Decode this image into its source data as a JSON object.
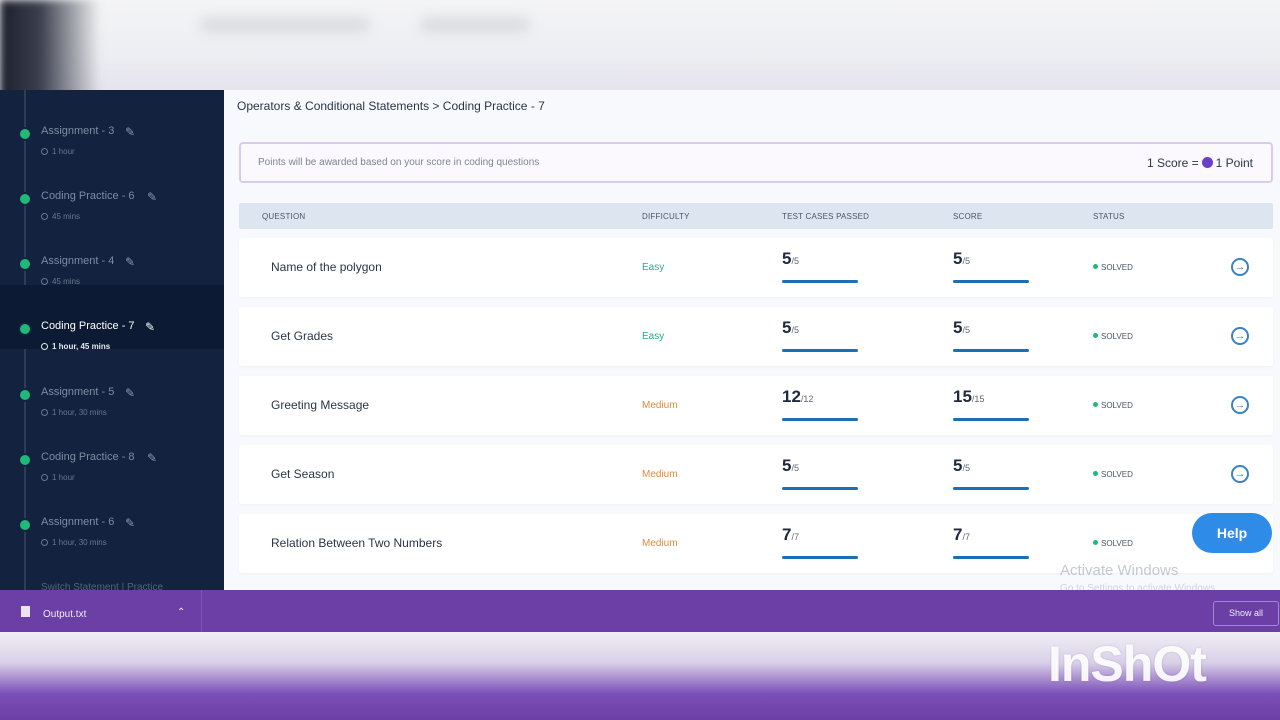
{
  "breadcrumb": "Operators & Conditional Statements > Coding Practice - 7",
  "notice": {
    "message": "Points will be awarded based on your score in coding questions",
    "rule_left": "1 Score =",
    "rule_right": "1 Point"
  },
  "sidebar": {
    "items": [
      {
        "title": "Assignment - 3",
        "meta": "1 hour",
        "active": false
      },
      {
        "title": "Coding Practice - 6",
        "meta": "45 mins",
        "active": false
      },
      {
        "title": "Assignment - 4",
        "meta": "45 mins",
        "active": false
      },
      {
        "title": "Coding Practice - 7",
        "meta": "1 hour, 45 mins",
        "active": true
      },
      {
        "title": "Assignment - 5",
        "meta": "1 hour, 30 mins",
        "active": false
      },
      {
        "title": "Coding Practice - 8",
        "meta": "1 hour",
        "active": false
      },
      {
        "title": "Assignment - 6",
        "meta": "1 hour, 30 mins",
        "active": false
      }
    ],
    "cutoff_label": "Switch Statement | Practice"
  },
  "table": {
    "headers": {
      "question": "QUESTION",
      "difficulty": "DIFFICULTY",
      "tests": "TEST CASES PASSED",
      "score": "SCORE",
      "status": "STATUS"
    },
    "rows": [
      {
        "question": "Name of the polygon",
        "difficulty": "Easy",
        "tests_passed": "5",
        "tests_total": "/5",
        "score": "5",
        "score_total": "/5",
        "status": "SOLVED"
      },
      {
        "question": "Get Grades",
        "difficulty": "Easy",
        "tests_passed": "5",
        "tests_total": "/5",
        "score": "5",
        "score_total": "/5",
        "status": "SOLVED"
      },
      {
        "question": "Greeting Message",
        "difficulty": "Medium",
        "tests_passed": "12",
        "tests_total": "/12",
        "score": "15",
        "score_total": "/15",
        "status": "SOLVED"
      },
      {
        "question": "Get Season",
        "difficulty": "Medium",
        "tests_passed": "5",
        "tests_total": "/5",
        "score": "5",
        "score_total": "/5",
        "status": "SOLVED"
      },
      {
        "question": "Relation Between Two Numbers",
        "difficulty": "Medium",
        "tests_passed": "7",
        "tests_total": "/7",
        "score": "7",
        "score_total": "/7",
        "status": "SOLVED"
      }
    ]
  },
  "help_label": "Help",
  "windows_watermark": {
    "title": "Activate Windows",
    "subtitle": "Go to Settings to activate Windows."
  },
  "download_bar": {
    "file_name": "Output.txt",
    "show_all": "Show all"
  },
  "video_watermark": "InShOt",
  "colors": {
    "sidebar_bg": "#13223f",
    "accent_blue": "#1d6fb5",
    "easy": "#27ae8a",
    "medium": "#e08a3c",
    "solved_dot": "#1fb978",
    "download_bar": "#6c3fa6",
    "help_button": "#2f8be8"
  }
}
